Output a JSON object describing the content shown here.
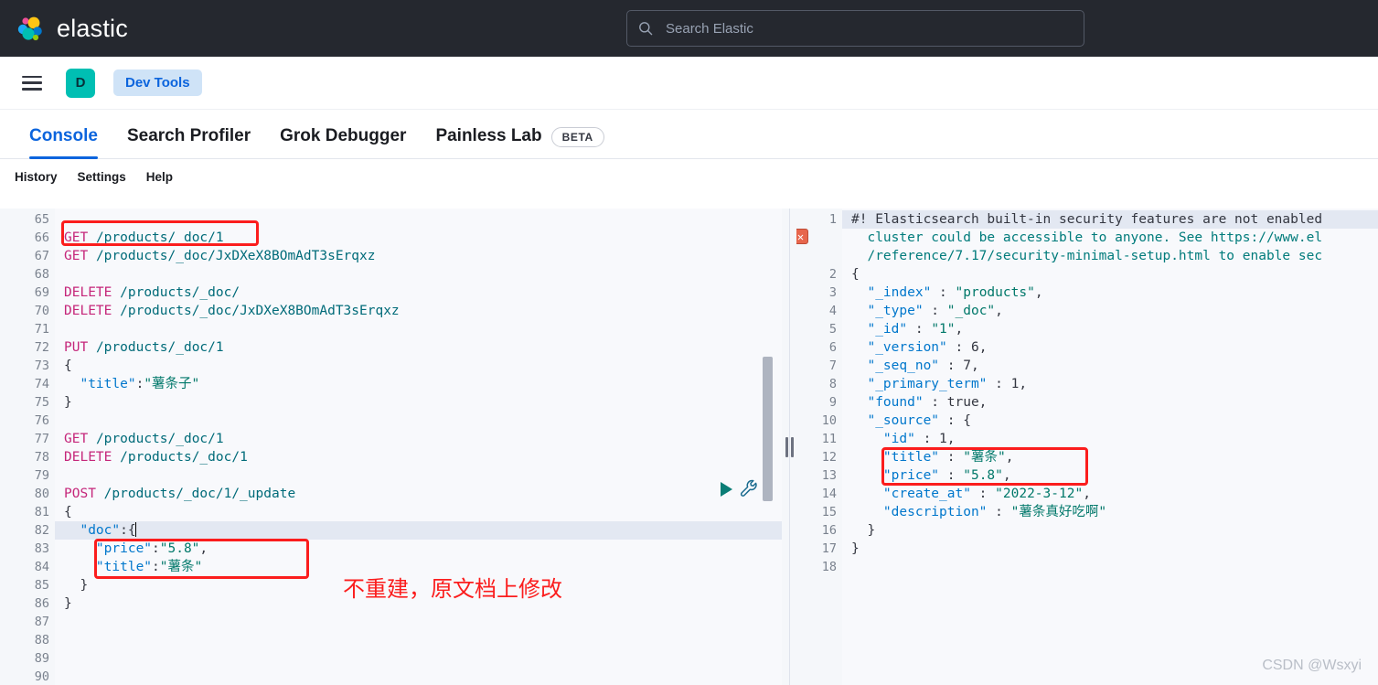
{
  "header": {
    "brand_name": "elastic",
    "logo_icon": "elastic-logo-icon",
    "search": {
      "icon": "search-icon",
      "placeholder": "Search Elastic",
      "value": ""
    }
  },
  "subheader": {
    "menu_icon": "hamburger-menu-icon",
    "space_avatar_label": "D",
    "breadcrumb_label": "Dev Tools"
  },
  "tabs": [
    {
      "label": "Console",
      "active": true
    },
    {
      "label": "Search Profiler",
      "active": false
    },
    {
      "label": "Grok Debugger",
      "active": false
    },
    {
      "label": "Painless Lab",
      "active": false
    }
  ],
  "beta_badge": "BETA",
  "console_toolbar": [
    {
      "label": "History"
    },
    {
      "label": "Settings"
    },
    {
      "label": "Help"
    }
  ],
  "actions": {
    "play_icon": "play-request-icon",
    "wrench_icon": "wrench-icon"
  },
  "editor": {
    "first_line_number": 65,
    "lines": [
      {
        "n": 65,
        "text": "",
        "fold": ""
      },
      {
        "n": 66,
        "text": "GET /products/_doc/1",
        "fold": ""
      },
      {
        "n": 67,
        "text": "GET /products/_doc/JxDXeX8BOmAdT3sErqxz",
        "fold": ""
      },
      {
        "n": 68,
        "text": "",
        "fold": ""
      },
      {
        "n": 69,
        "text": "DELETE /products/_doc/",
        "fold": ""
      },
      {
        "n": 70,
        "text": "DELETE /products/_doc/JxDXeX8BOmAdT3sErqxz",
        "fold": ""
      },
      {
        "n": 71,
        "text": "",
        "fold": ""
      },
      {
        "n": 72,
        "text": "PUT /products/_doc/1",
        "fold": ""
      },
      {
        "n": 73,
        "text": "{",
        "fold": "down"
      },
      {
        "n": 74,
        "text": "  \"title\":\"薯条子\"",
        "fold": ""
      },
      {
        "n": 75,
        "text": "}",
        "fold": "up"
      },
      {
        "n": 76,
        "text": "",
        "fold": ""
      },
      {
        "n": 77,
        "text": "GET /products/_doc/1",
        "fold": ""
      },
      {
        "n": 78,
        "text": "DELETE /products/_doc/1",
        "fold": ""
      },
      {
        "n": 79,
        "text": "",
        "fold": ""
      },
      {
        "n": 80,
        "text": "POST /products/_doc/1/_update",
        "fold": ""
      },
      {
        "n": 81,
        "text": "{",
        "fold": "down"
      },
      {
        "n": 82,
        "text": "  \"doc\":{",
        "fold": "down"
      },
      {
        "n": 83,
        "text": "    \"price\":\"5.8\",",
        "fold": ""
      },
      {
        "n": 84,
        "text": "    \"title\":\"薯条\"",
        "fold": ""
      },
      {
        "n": 85,
        "text": "  }",
        "fold": "up"
      },
      {
        "n": 86,
        "text": "}",
        "fold": "up"
      },
      {
        "n": 87,
        "text": "",
        "fold": ""
      },
      {
        "n": 88,
        "text": "",
        "fold": ""
      },
      {
        "n": 89,
        "text": "",
        "fold": ""
      },
      {
        "n": 90,
        "text": "",
        "fold": ""
      }
    ],
    "cursor_line": 82
  },
  "response": {
    "error_icon": "error-x-icon",
    "lines": [
      {
        "n": 1,
        "text": "#! Elasticsearch built-in security features are not enabled",
        "fold": ""
      },
      {
        "n": "",
        "text": "  cluster could be accessible to anyone. See https://www.el",
        "fold": ""
      },
      {
        "n": "",
        "text": "  /reference/7.17/security-minimal-setup.html to enable sec",
        "fold": ""
      },
      {
        "n": 2,
        "text": "{",
        "fold": "down"
      },
      {
        "n": 3,
        "text": "  \"_index\" : \"products\",",
        "fold": ""
      },
      {
        "n": 4,
        "text": "  \"_type\" : \"_doc\",",
        "fold": ""
      },
      {
        "n": 5,
        "text": "  \"_id\" : \"1\",",
        "fold": ""
      },
      {
        "n": 6,
        "text": "  \"_version\" : 6,",
        "fold": ""
      },
      {
        "n": 7,
        "text": "  \"_seq_no\" : 7,",
        "fold": ""
      },
      {
        "n": 8,
        "text": "  \"_primary_term\" : 1,",
        "fold": ""
      },
      {
        "n": 9,
        "text": "  \"found\" : true,",
        "fold": ""
      },
      {
        "n": 10,
        "text": "  \"_source\" : {",
        "fold": "down"
      },
      {
        "n": 11,
        "text": "    \"id\" : 1,",
        "fold": ""
      },
      {
        "n": 12,
        "text": "    \"title\" : \"薯条\",",
        "fold": ""
      },
      {
        "n": 13,
        "text": "    \"price\" : \"5.8\",",
        "fold": ""
      },
      {
        "n": 14,
        "text": "    \"create_at\" : \"2022-3-12\",",
        "fold": ""
      },
      {
        "n": 15,
        "text": "    \"description\" : \"薯条真好吃啊\"",
        "fold": ""
      },
      {
        "n": 16,
        "text": "  }",
        "fold": "up"
      },
      {
        "n": 17,
        "text": "}",
        "fold": "up"
      },
      {
        "n": 18,
        "text": "",
        "fold": ""
      }
    ]
  },
  "annotations": {
    "note_text": "不重建，原文档上修改",
    "color": "#fb1d1d"
  },
  "watermark": "CSDN @Wsxyi",
  "colors": {
    "brand_dark": "#25282f",
    "accent_blue": "#0b64dd",
    "teal": "#00bfb3",
    "annotation_red": "#fb1d1d"
  }
}
